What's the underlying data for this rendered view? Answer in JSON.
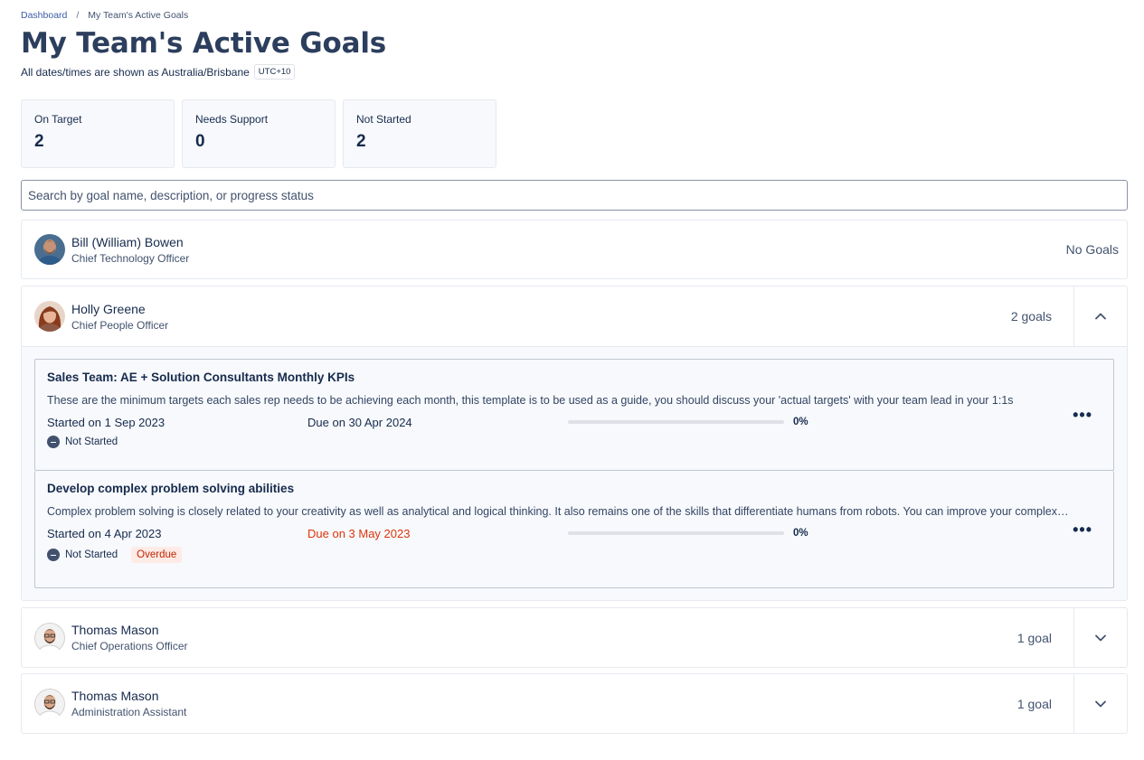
{
  "breadcrumb": {
    "home": "Dashboard",
    "separator": "/",
    "current": "My Team's Active Goals"
  },
  "page": {
    "title": "My Team's Active Goals",
    "timezone_text": "All dates/times are shown as Australia/Brisbane",
    "timezone_badge": "UTC+10"
  },
  "stats": [
    {
      "label": "On Target",
      "value": "2"
    },
    {
      "label": "Needs Support",
      "value": "0"
    },
    {
      "label": "Not Started",
      "value": "2"
    }
  ],
  "search": {
    "placeholder": "Search by goal name, description, or progress status",
    "value": ""
  },
  "people": [
    {
      "name": "Bill (William) Bowen",
      "role": "Chief Technology Officer",
      "goal_count": "No Goals",
      "expanded": false,
      "avatar_colors": {
        "bg": "#4a6e8f",
        "skin": "#c89276",
        "hair": "#5a3f2e",
        "shirt": "#2e5c8a"
      }
    },
    {
      "name": "Holly Greene",
      "role": "Chief People Officer",
      "goal_count": "2 goals",
      "expanded": true,
      "avatar_colors": {
        "bg": "#e7d5c8",
        "skin": "#e8b597",
        "hair": "#8a3b1e",
        "shirt": "#8c5a44"
      },
      "goals": [
        {
          "title": "Sales Team: AE + Solution Consultants Monthly KPIs",
          "description": "These are the minimum targets each sales rep needs to be achieving each month, this template is to be used as a guide, you should discuss your 'actual targets' with your team lead in your 1:1s",
          "started": "Started on 1 Sep 2023",
          "due": "Due on 30 Apr 2024",
          "overdue": false,
          "progress": 0,
          "progress_label": "0%",
          "status": "Not Started",
          "badge": ""
        },
        {
          "title": "Develop complex problem solving abilities",
          "description": "Complex problem solving is closely related to your creativity as well as analytical and logical thinking. It also remains one of the skills that differentiate humans from robots. You can improve your complex problem solving skills",
          "started": "Started on 4 Apr 2023",
          "due": "Due on 3 May 2023",
          "overdue": true,
          "progress": 0,
          "progress_label": "0%",
          "status": "Not Started",
          "badge": "Overdue"
        }
      ]
    },
    {
      "name": "Thomas Mason",
      "role": "Chief Operations Officer",
      "goal_count": "1 goal",
      "expanded": false,
      "avatar_colors": {
        "bg": "#f2f2f2",
        "skin": "#d9a88a",
        "hair": "#3b2a20",
        "shirt": "#ffffff"
      }
    },
    {
      "name": "Thomas Mason",
      "role": "Administration Assistant",
      "goal_count": "1 goal",
      "expanded": false,
      "avatar_colors": {
        "bg": "#f2f2f2",
        "skin": "#d9a88a",
        "hair": "#3b2a20",
        "shirt": "#ffffff"
      }
    }
  ],
  "colors": {
    "accent": "#3b5ba8",
    "overdue": "#de350b",
    "overdue_badge_bg": "#ffebe6"
  },
  "icons": {
    "chevron_up": "chevron-up-icon",
    "chevron_down": "chevron-down-icon",
    "more": "more-horizontal-icon",
    "status": "minus-circle-icon"
  }
}
